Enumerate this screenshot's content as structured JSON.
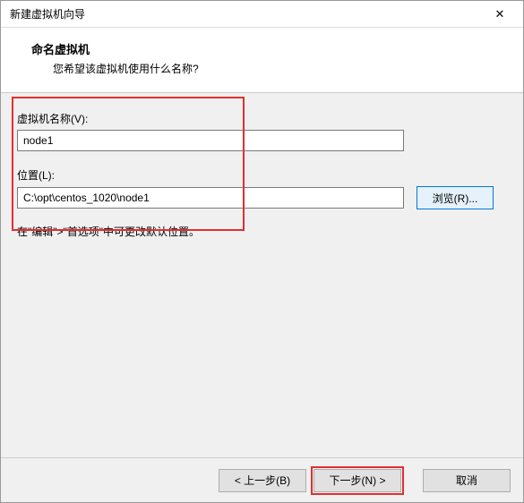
{
  "window": {
    "title": "新建虚拟机向导",
    "close_icon": "✕"
  },
  "header": {
    "title": "命名虚拟机",
    "subtitle": "您希望该虚拟机使用什么名称?"
  },
  "form": {
    "name_label": "虚拟机名称(V):",
    "name_value": "node1",
    "location_label": "位置(L):",
    "location_value": "C:\\opt\\centos_1020\\node1",
    "browse_label": "浏览(R)...",
    "hint": "在\"编辑\">\"首选项\"中可更改默认位置。"
  },
  "footer": {
    "back_label": "< 上一步(B)",
    "next_label": "下一步(N) >",
    "cancel_label": "取消"
  }
}
